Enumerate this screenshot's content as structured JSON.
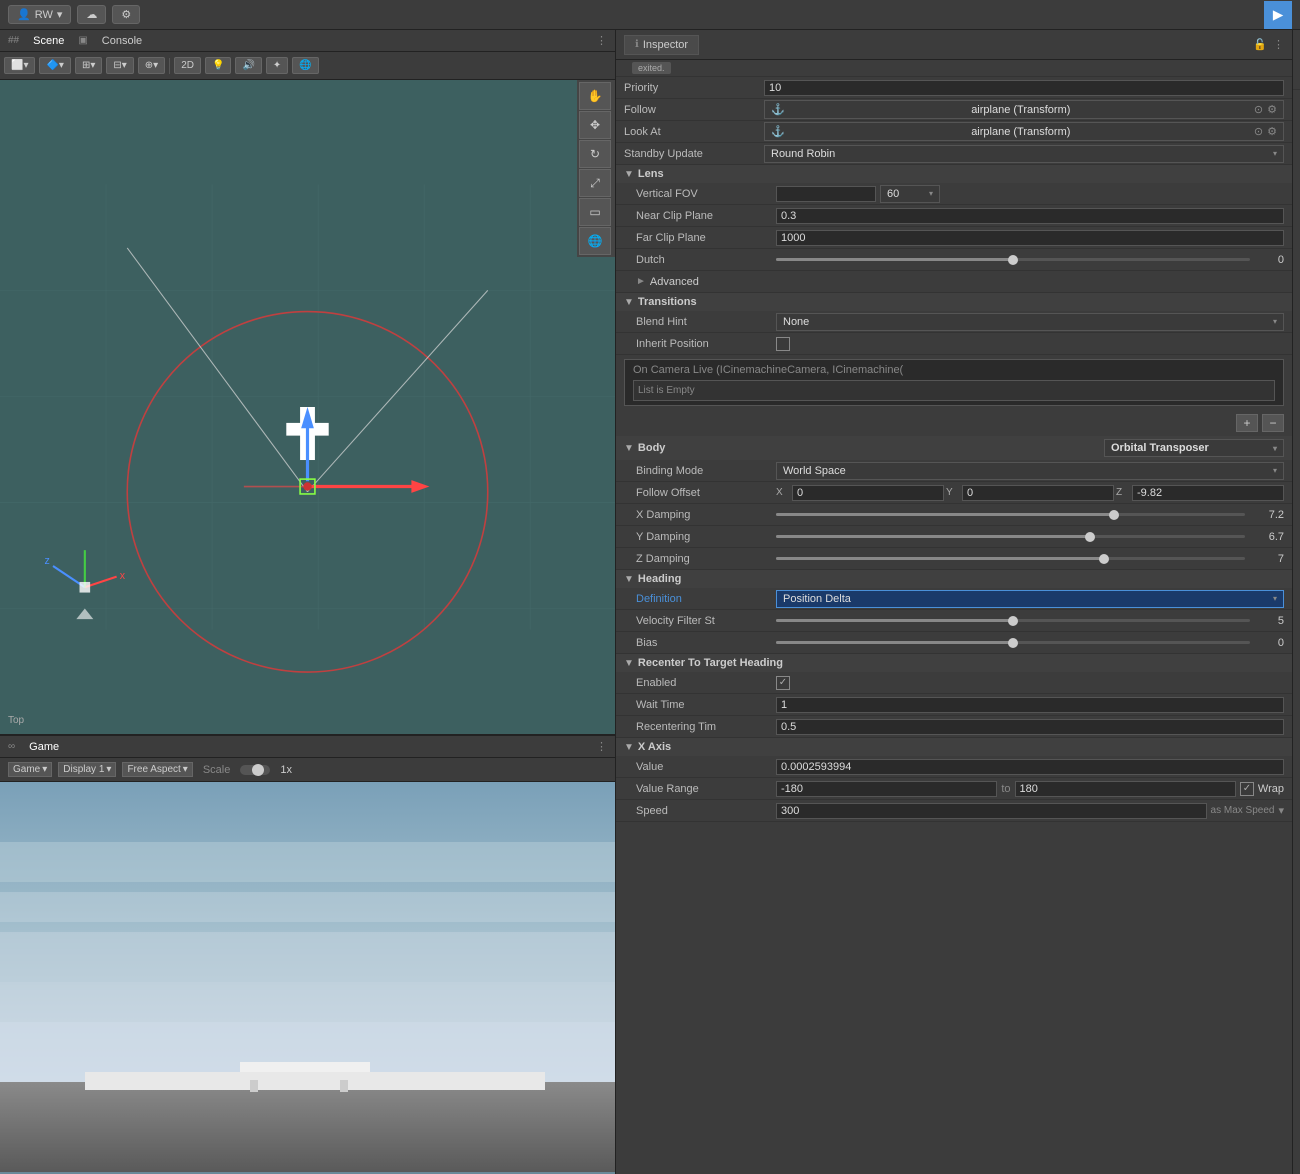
{
  "topbar": {
    "user": "RW",
    "play_btn": "▶"
  },
  "scene": {
    "tab_scene": "Scene",
    "tab_console": "Console",
    "label_2d": "2D",
    "label_top": "Top"
  },
  "game": {
    "tab_label": "Game",
    "display": "Display 1",
    "aspect": "Free Aspect",
    "scale_label": "Scale",
    "scale_val": "1x"
  },
  "inspector": {
    "tab_label": "Inspector",
    "exited": "exited.",
    "priority_label": "Priority",
    "priority_val": "10",
    "follow_label": "Follow",
    "follow_val": "airplane (Transform)",
    "look_at_label": "Look At",
    "look_at_val": "airplane (Transform)",
    "standby_label": "Standby Update",
    "standby_val": "Round Robin",
    "lens_label": "Lens",
    "vfov_label": "Vertical FOV",
    "vfov_val": "60",
    "near_clip_label": "Near Clip Plane",
    "near_clip_val": "0.3",
    "far_clip_label": "Far Clip Plane",
    "far_clip_val": "1000",
    "dutch_label": "Dutch",
    "dutch_val": "0",
    "dutch_slider_pct": "50",
    "advanced_label": "Advanced",
    "transitions_label": "Transitions",
    "blend_hint_label": "Blend Hint",
    "blend_hint_val": "None",
    "inherit_pos_label": "Inherit Position",
    "event_label": "On Camera Live (ICinemachineCamera, ICinemachine(",
    "list_empty": "List is Empty",
    "body_label": "Body",
    "body_val": "Orbital Transposer",
    "binding_mode_label": "Binding Mode",
    "binding_mode_val": "World Space",
    "follow_offset_label": "Follow Offset",
    "fo_x": "0",
    "fo_y": "0",
    "fo_z": "-9.82",
    "x_damping_label": "X Damping",
    "x_damping_val": "7.2",
    "x_damping_pct": "72",
    "y_damping_label": "Y Damping",
    "y_damping_val": "6.7",
    "y_damping_pct": "67",
    "z_damping_label": "Z Damping",
    "z_damping_val": "7",
    "z_damping_pct": "70",
    "heading_label": "Heading",
    "definition_label": "Definition",
    "definition_val": "Position Delta",
    "vel_filter_label": "Velocity Filter St",
    "vel_filter_val": "5",
    "vel_filter_pct": "50",
    "bias_label": "Bias",
    "bias_val": "0",
    "bias_pct": "50",
    "recenter_label": "Recenter To Target Heading",
    "enabled_label": "Enabled",
    "wait_time_label": "Wait Time",
    "wait_time_val": "1",
    "recenter_time_label": "Recentering Tim",
    "recenter_time_val": "0.5",
    "x_axis_label": "X Axis",
    "value_label": "Value",
    "value_val": "0.0002593994",
    "value_range_label": "Value Range",
    "vr_min": "-180",
    "vr_to": "to",
    "vr_max": "180",
    "vr_wrap": "Wrap",
    "speed_label": "Speed",
    "speed_val": "300",
    "speed_suffix": "as Max Speed"
  }
}
